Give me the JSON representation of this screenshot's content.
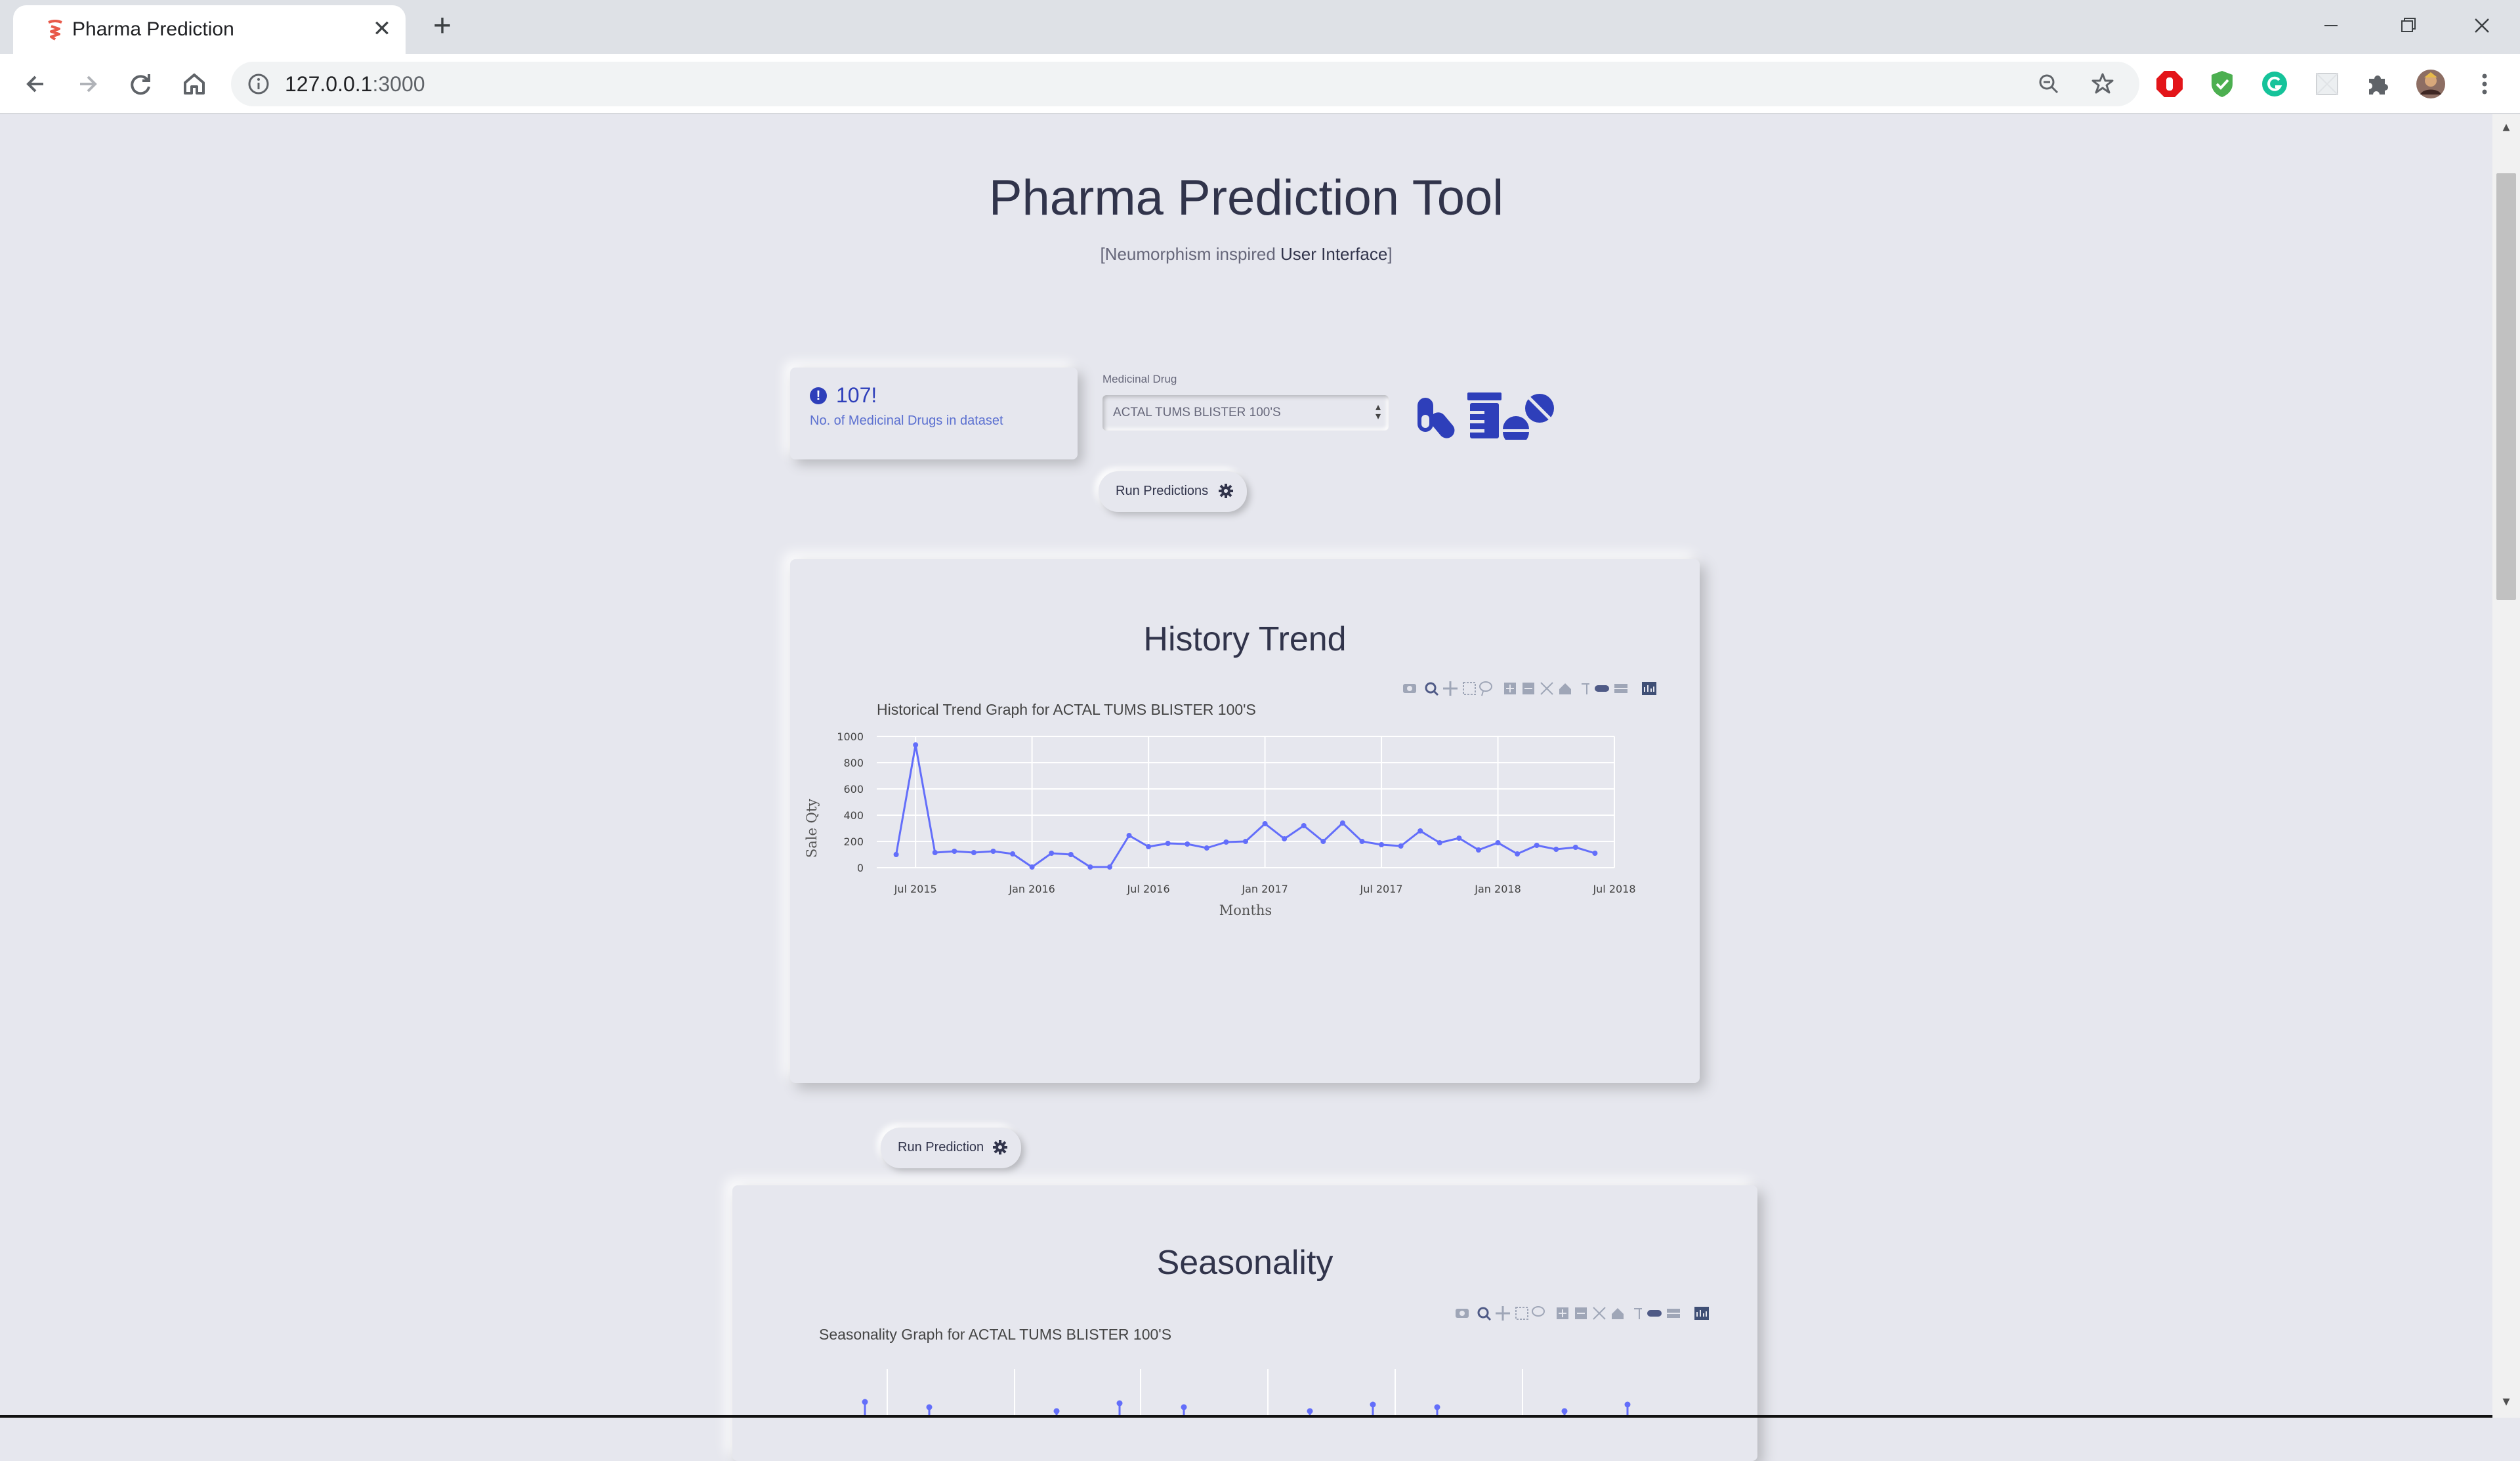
{
  "browser": {
    "tab_title": "Pharma Prediction",
    "url_host": "127.0.0.1",
    "url_port": ":3000"
  },
  "header": {
    "title": "Pharma Prediction Tool",
    "subtitle_prefix": "[Neumorphism inspired ",
    "subtitle_bold": "User Interface",
    "subtitle_suffix": "]"
  },
  "stat": {
    "icon": "exclamation-circle-icon",
    "value": "107!",
    "label": "No. of Medicinal Drugs in dataset"
  },
  "drug_select": {
    "label": "Medicinal Drug",
    "value": "ACTAL TUMS BLISTER 100'S"
  },
  "buttons": {
    "run_predictions": "Run Predictions",
    "run_prediction": "Run Prediction"
  },
  "history": {
    "card_title": "History Trend",
    "plot_title": "Historical Trend Graph for ACTAL TUMS BLISTER 100'S"
  },
  "seasonality": {
    "card_title": "Seasonality",
    "plot_title": "Seasonality Graph for ACTAL TUMS BLISTER 100'S"
  },
  "colors": {
    "accent": "#2e3fba",
    "line": "#636efa",
    "background": "#e6e7ee"
  },
  "chart_data": {
    "type": "line",
    "xlabel": "Months",
    "ylabel": "Sale Qty",
    "ylim": [
      0,
      1000
    ],
    "yticks": [
      0,
      200,
      400,
      600,
      800,
      1000
    ],
    "xticks": [
      "Jul 2015",
      "Jan 2016",
      "Jul 2016",
      "Jan 2017",
      "Jul 2017",
      "Jan 2018",
      "Jul 2018"
    ],
    "grid": true,
    "x": [
      "2015-06",
      "2015-07",
      "2015-08",
      "2015-09",
      "2015-10",
      "2015-11",
      "2015-12",
      "2016-01",
      "2016-02",
      "2016-03",
      "2016-04",
      "2016-05",
      "2016-06",
      "2016-07",
      "2016-08",
      "2016-09",
      "2016-10",
      "2016-11",
      "2016-12",
      "2017-01",
      "2017-02",
      "2017-03",
      "2017-04",
      "2017-05",
      "2017-06",
      "2017-07",
      "2017-08",
      "2017-09",
      "2017-10",
      "2017-11",
      "2017-12",
      "2018-01",
      "2018-02",
      "2018-03",
      "2018-04",
      "2018-05",
      "2018-06"
    ],
    "values": [
      100,
      935,
      115,
      125,
      115,
      125,
      105,
      5,
      110,
      100,
      5,
      5,
      245,
      160,
      185,
      180,
      150,
      195,
      200,
      335,
      220,
      320,
      200,
      340,
      200,
      175,
      165,
      280,
      190,
      225,
      135,
      190,
      105,
      170,
      140,
      155,
      110
    ]
  }
}
